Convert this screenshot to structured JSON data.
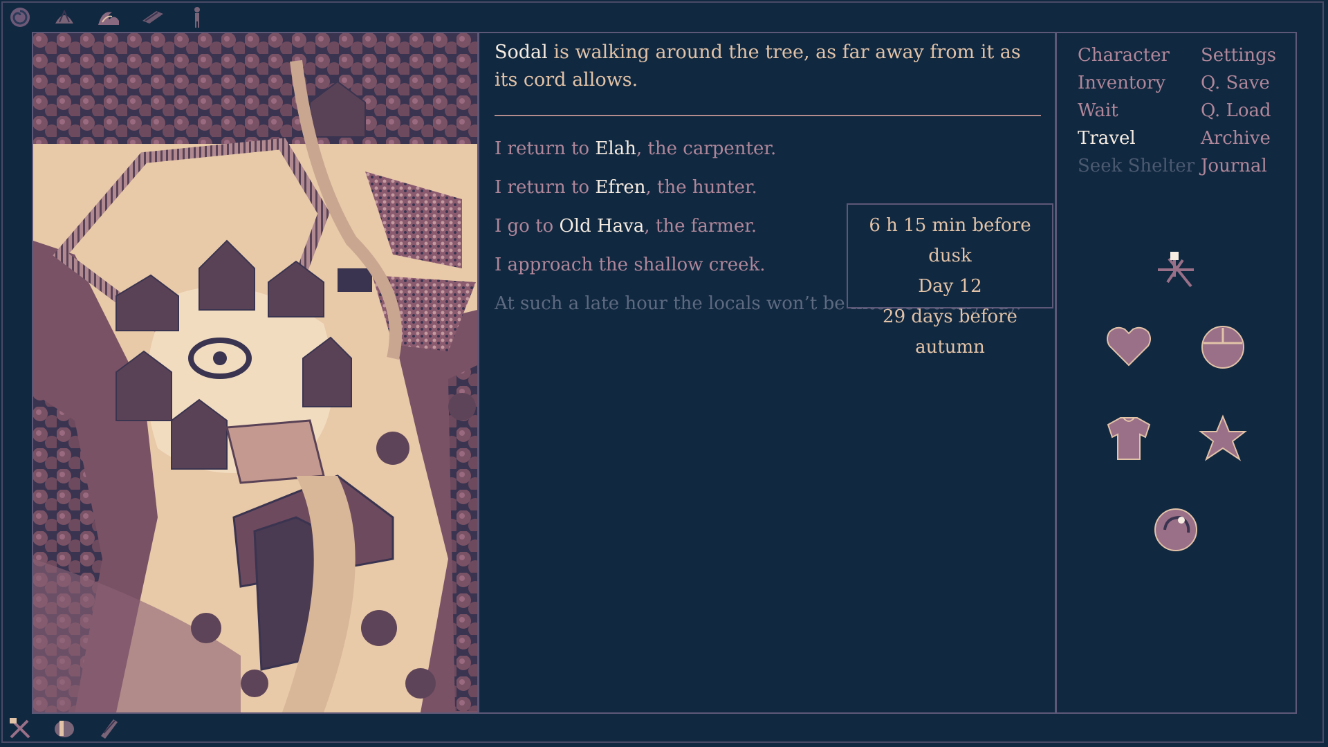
{
  "top_icons": [
    "spiral-icon",
    "shell-icon",
    "wave-icon",
    "plank-icon",
    "figure-icon"
  ],
  "bottom_icons": [
    "crossed-tools-icon",
    "pouch-icon",
    "bandage-icon"
  ],
  "narration": {
    "subject": "Sodal",
    "rest": " is walking around the tree, as far away from it as its cord allows."
  },
  "choices": [
    {
      "pre": "I return to ",
      "name": "Elah",
      "post": ", the carpenter."
    },
    {
      "pre": "I return to ",
      "name": "Efren",
      "post": ", the hunter."
    },
    {
      "pre": "I go to ",
      "name": "Old Hava",
      "post": ", the farmer."
    },
    {
      "pre": "I approach the shallow creek.",
      "name": "",
      "post": ""
    }
  ],
  "disabled_note": "At such a late hour the locals won’t be interested anyway.",
  "tooltip": {
    "line1": "6 h 15 min before dusk",
    "line2": "Day 12",
    "line3": "29 days before autumn"
  },
  "menu_left": {
    "character": "Character",
    "inventory": "Inventory",
    "wait": "Wait",
    "travel": "Travel",
    "seek_shelter": "Seek Shelter"
  },
  "menu_right": {
    "settings": "Settings",
    "qsave": "Q. Save",
    "qload": "Q. Load",
    "archive": "Archive",
    "journal": "Journal"
  },
  "status_icons": [
    "compass-icon",
    "heart-icon",
    "food-bowl-icon",
    "shirt-icon",
    "star-icon",
    "orb-icon"
  ],
  "colors": {
    "background": "#102840",
    "frame": "#5e5878",
    "text": "#e2c3a8",
    "highlight": "#f6ece2",
    "choice": "#b0879a",
    "disabled": "#5e6a80",
    "icon": "#9a7088"
  }
}
